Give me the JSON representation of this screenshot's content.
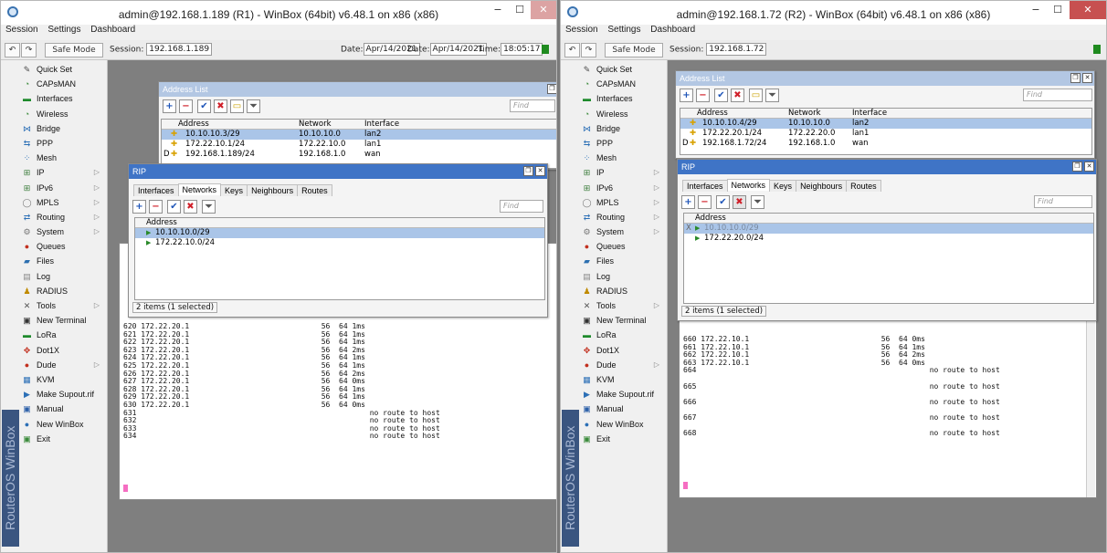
{
  "left": {
    "title": "admin@192.168.1.189 (R1) - WinBox (64bit) v6.48.1 on x86 (x86)",
    "menus": [
      "Session",
      "Settings",
      "Dashboard"
    ],
    "safe_mode": "Safe Mode",
    "session_label": "Session:",
    "session": "192.168.1.189",
    "date1_label": "Date:",
    "date1": "Apr/14/2021",
    "date2_label": "Date:",
    "date2": "Apr/14/2021",
    "time_label": "Time:",
    "time": "18:05:17",
    "brand": "RouterOS WinBox",
    "address_list": {
      "title": "Address List",
      "find": "Find",
      "headers": [
        "Address",
        "Network",
        "Interface"
      ],
      "rows": [
        {
          "flag": "",
          "address": "10.10.10.3/29",
          "network": "10.10.10.0",
          "interface": "lan2",
          "selected": true
        },
        {
          "flag": "",
          "address": "172.22.10.1/24",
          "network": "172.22.10.0",
          "interface": "lan1",
          "selected": false
        },
        {
          "flag": "D",
          "address": "192.168.1.189/24",
          "network": "192.168.1.0",
          "interface": "wan",
          "selected": false
        }
      ]
    },
    "rip": {
      "title": "RIP",
      "tabs": [
        "Interfaces",
        "Networks",
        "Keys",
        "Neighbours",
        "Routes"
      ],
      "active_tab": "Networks",
      "find": "Find",
      "header": "Address",
      "rows": [
        {
          "flag": "",
          "address": "10.10.10.0/29",
          "selected": true
        },
        {
          "flag": "",
          "address": "172.22.10.0/24",
          "selected": false
        }
      ],
      "status": "2 items (1 selected)"
    },
    "terminal": [
      "620 172.22.20.1                              56  64 1ms",
      "621 172.22.20.1                              56  64 1ms",
      "622 172.22.20.1                              56  64 1ms",
      "623 172.22.20.1                              56  64 2ms",
      "624 172.22.20.1                              56  64 1ms",
      "625 172.22.20.1                              56  64 1ms",
      "626 172.22.20.1                              56  64 2ms",
      "627 172.22.20.1                              56  64 0ms",
      "628 172.22.20.1                              56  64 1ms",
      "629 172.22.20.1                              56  64 1ms",
      "630 172.22.20.1                              56  64 0ms",
      "631                                                     no route to host",
      "632                                                     no route to host",
      "633                                                     no route to host",
      "634                                                     no route to host"
    ]
  },
  "right": {
    "title": "admin@192.168.1.72 (R2) - WinBox (64bit) v6.48.1 on x86 (x86)",
    "menus": [
      "Session",
      "Settings",
      "Dashboard"
    ],
    "safe_mode": "Safe Mode",
    "session_label": "Session:",
    "session": "192.168.1.72",
    "brand": "RouterOS WinBox",
    "address_list": {
      "title": "Address List",
      "find": "Find",
      "headers": [
        "Address",
        "Network",
        "Interface"
      ],
      "rows": [
        {
          "flag": "",
          "address": "10.10.10.4/29",
          "network": "10.10.10.0",
          "interface": "lan2",
          "selected": true
        },
        {
          "flag": "",
          "address": "172.22.20.1/24",
          "network": "172.22.20.0",
          "interface": "lan1",
          "selected": false
        },
        {
          "flag": "D",
          "address": "192.168.1.72/24",
          "network": "192.168.1.0",
          "interface": "wan",
          "selected": false
        }
      ]
    },
    "rip": {
      "title": "RIP",
      "tabs": [
        "Interfaces",
        "Networks",
        "Keys",
        "Neighbours",
        "Routes"
      ],
      "active_tab": "Networks",
      "find": "Find",
      "header": "Address",
      "rows": [
        {
          "flag": "X",
          "address": "10.10.10.0/29",
          "selected": true
        },
        {
          "flag": "",
          "address": "172.22.20.0/24",
          "selected": false
        }
      ],
      "status": "2 items (1 selected)"
    },
    "terminal": [
      "660 172.22.10.1                              56  64 0ms",
      "661 172.22.10.1                              56  64 1ms",
      "662 172.22.10.1                              56  64 2ms",
      "663 172.22.10.1                              56  64 0ms",
      "664                                                     no route to host",
      "",
      "665                                                     no route to host",
      "",
      "666                                                     no route to host",
      "",
      "667                                                     no route to host",
      "",
      "668                                                     no route to host"
    ]
  },
  "sidebar_items": [
    {
      "label": "Quick Set",
      "icon": "quickset-icon",
      "glyph": "✎",
      "color": "#4a4a4a",
      "arrow": false
    },
    {
      "label": "CAPsMAN",
      "icon": "capsman-icon",
      "glyph": "◔",
      "color": "#3a8a3a",
      "arrow": false
    },
    {
      "label": "Interfaces",
      "icon": "interfaces-icon",
      "glyph": "▬",
      "color": "#1d8a2b",
      "arrow": false
    },
    {
      "label": "Wireless",
      "icon": "wireless-icon",
      "glyph": "◔",
      "color": "#3a8a3a",
      "arrow": false
    },
    {
      "label": "Bridge",
      "icon": "bridge-icon",
      "glyph": "⋈",
      "color": "#2b6fb6",
      "arrow": false
    },
    {
      "label": "PPP",
      "icon": "ppp-icon",
      "glyph": "⇆",
      "color": "#2b6fb6",
      "arrow": false
    },
    {
      "label": "Mesh",
      "icon": "mesh-icon",
      "glyph": "⁘",
      "color": "#2b6fb6",
      "arrow": false
    },
    {
      "label": "IP",
      "icon": "ip-icon",
      "glyph": "⊞",
      "color": "#3c7d3c",
      "arrow": true
    },
    {
      "label": "IPv6",
      "icon": "ipv6-icon",
      "glyph": "⊞",
      "color": "#3c7d3c",
      "arrow": true
    },
    {
      "label": "MPLS",
      "icon": "mpls-icon",
      "glyph": "◯",
      "color": "#7a7a7a",
      "arrow": true
    },
    {
      "label": "Routing",
      "icon": "routing-icon",
      "glyph": "⇄",
      "color": "#2b6fb6",
      "arrow": true
    },
    {
      "label": "System",
      "icon": "system-icon",
      "glyph": "⚙",
      "color": "#777",
      "arrow": true
    },
    {
      "label": "Queues",
      "icon": "queues-icon",
      "glyph": "●",
      "color": "#c2301f",
      "arrow": false
    },
    {
      "label": "Files",
      "icon": "files-icon",
      "glyph": "▰",
      "color": "#2c6fb0",
      "arrow": false
    },
    {
      "label": "Log",
      "icon": "log-icon",
      "glyph": "▤",
      "color": "#888",
      "arrow": false
    },
    {
      "label": "RADIUS",
      "icon": "radius-icon",
      "glyph": "♟",
      "color": "#c08a00",
      "arrow": false
    },
    {
      "label": "Tools",
      "icon": "tools-icon",
      "glyph": "✕",
      "color": "#555",
      "arrow": true
    },
    {
      "label": "New Terminal",
      "icon": "terminal-icon",
      "glyph": "▣",
      "color": "#333",
      "arrow": false
    },
    {
      "label": "LoRa",
      "icon": "lora-icon",
      "glyph": "▬",
      "color": "#1d8a2b",
      "arrow": false
    },
    {
      "label": "Dot1X",
      "icon": "dot1x-icon",
      "glyph": "✥",
      "color": "#c2301f",
      "arrow": false
    },
    {
      "label": "Dude",
      "icon": "dude-icon",
      "glyph": "●",
      "color": "#c2301f",
      "arrow": true
    },
    {
      "label": "KVM",
      "icon": "kvm-icon",
      "glyph": "▦",
      "color": "#2b6fb6",
      "arrow": false
    },
    {
      "label": "Make Supout.rif",
      "icon": "supout-icon",
      "glyph": "▶",
      "color": "#2b6fb6",
      "arrow": false
    },
    {
      "label": "Manual",
      "icon": "manual-icon",
      "glyph": "▣",
      "color": "#2b5fa8",
      "arrow": false
    },
    {
      "label": "New WinBox",
      "icon": "winbox-icon",
      "glyph": "●",
      "color": "#2b6fb6",
      "arrow": false
    },
    {
      "label": "Exit",
      "icon": "exit-icon",
      "glyph": "▣",
      "color": "#3a8a3a",
      "arrow": false
    }
  ],
  "colors": {
    "selection": "#aac5e8",
    "active_title": "#3f74c6",
    "inactive_title": "#b3c7e3",
    "cursor": "#f56ec2"
  }
}
